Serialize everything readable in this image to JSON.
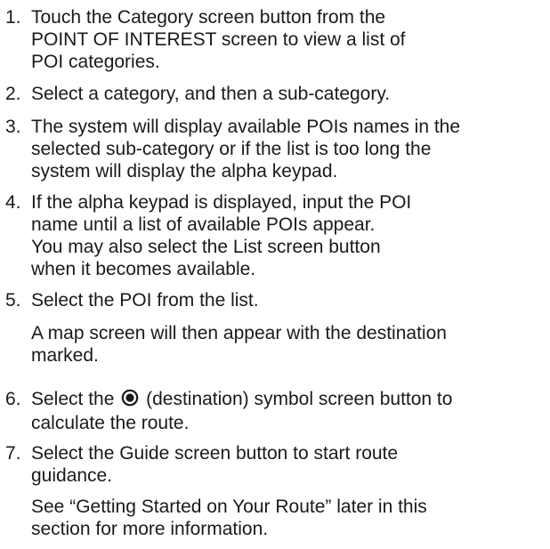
{
  "steps": [
    {
      "number": "1.",
      "lines": [
        "Touch the Category screen button from the",
        "POINT OF INTEREST screen to view a list of",
        "POI categories."
      ]
    },
    {
      "number": "2.",
      "lines": [
        "Select a category, and then a sub-category."
      ]
    },
    {
      "number": "3.",
      "lines": [
        "The system will display available POIs names in the",
        "selected sub-category or if the list is too long the",
        "system will display the alpha keypad."
      ]
    },
    {
      "number": "4.",
      "lines": [
        "If the alpha keypad is displayed, input the POI",
        "name until a list of available POIs appear.",
        "You may also select the List screen button",
        "when it becomes available."
      ]
    },
    {
      "number": "5.",
      "lines": [
        "Select the POI from the list."
      ],
      "note_lines": [
        "A map screen will then appear with the destination",
        "marked."
      ]
    },
    {
      "number": "6.",
      "line1_before": "Select the",
      "line1_after": "(destination) symbol screen button to",
      "lines_rest": [
        "calculate the route."
      ],
      "symbol_icon": "destination-symbol-icon"
    },
    {
      "number": "7.",
      "lines": [
        "Select the Guide screen button to start route",
        "guidance."
      ],
      "note_lines": [
        "See “Getting Started on Your Route” later in this",
        "section for more information."
      ]
    }
  ]
}
